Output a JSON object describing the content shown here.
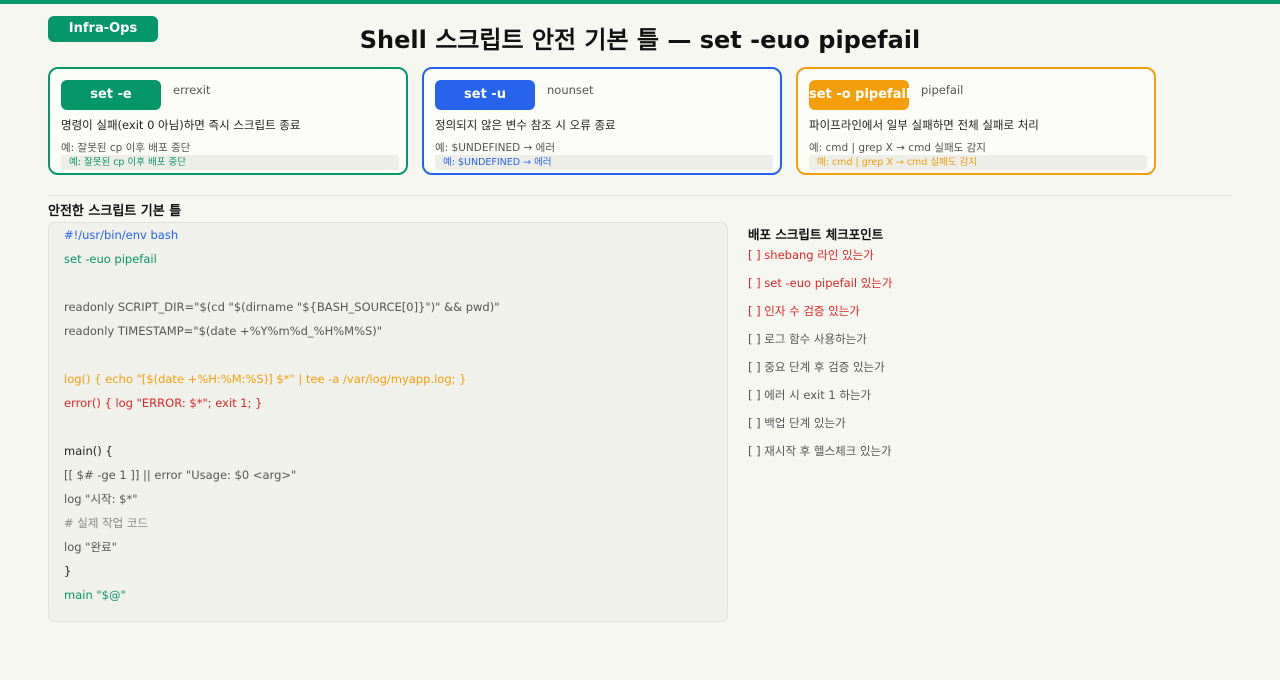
{
  "header": {
    "badge": "Infra-Ops",
    "title": "Shell 스크립트 안전 기본 틀 — set -euo pipefail"
  },
  "colors": {
    "green": "#059669",
    "blue": "#2563eb",
    "orange": "#f59e0b",
    "red": "#dc2626",
    "gray": "#555555"
  },
  "cards": [
    {
      "flag": "set -e",
      "alias": "errexit",
      "description": "명령이 실패(exit 0 아님)하면 즉시 스크립트 종료",
      "example": "예: 잘못된 cp 이후 배포 중단",
      "example_highlight": "예: 잘못된 cp 이후 배포 중단"
    },
    {
      "flag": "set -u",
      "alias": "nounset",
      "description": "정의되지 않은 변수 참조 시 오류 종료",
      "example": "예: $UNDEFINED → 에러",
      "example_highlight": "예: $UNDEFINED → 에러"
    },
    {
      "flag": "set -o pipefail",
      "alias": "pipefail",
      "description": "파이프라인에서 일부 실패하면 전체 실패로 처리",
      "example": "예: cmd | grep X → cmd 실패도 감지",
      "example_highlight": "예: cmd | grep X → cmd 실패도 감지"
    }
  ],
  "code_section": {
    "title": "안전한 스크립트 기본 틀",
    "lines": [
      "#!/usr/bin/env bash",
      "set -euo pipefail",
      "",
      "readonly SCRIPT_DIR=\"$(cd \"$(dirname \"${BASH_SOURCE[0]}\")\" && pwd)\"",
      "readonly TIMESTAMP=\"$(date +%Y%m%d_%H%M%S)\"",
      "",
      "log() { echo \"[$(date +%H:%M:%S)] $*\" | tee -a /var/log/myapp.log; }",
      "error() { log \"ERROR: $*\"; exit 1; }",
      "",
      "main() {",
      "[[ $# -ge 1 ]] || error \"Usage: $0 <arg>\"",
      "log \"시작: $*\"",
      "# 실제 작업 코드",
      "log \"완료\"",
      "}",
      "main \"$@\""
    ]
  },
  "checklist": {
    "title": "배포 스크립트 체크포인트",
    "items": [
      "[ ] shebang 라인 있는가",
      "[ ] set -euo pipefail 있는가",
      "[ ] 인자 수 검증 있는가",
      "[ ] 로그 함수 사용하는가",
      "[ ] 중요 단계 후 검증 있는가",
      "[ ] 에러 시 exit 1 하는가",
      "[ ] 백업 단계 있는가",
      "[ ] 재시작 후 헬스체크 있는가"
    ]
  }
}
